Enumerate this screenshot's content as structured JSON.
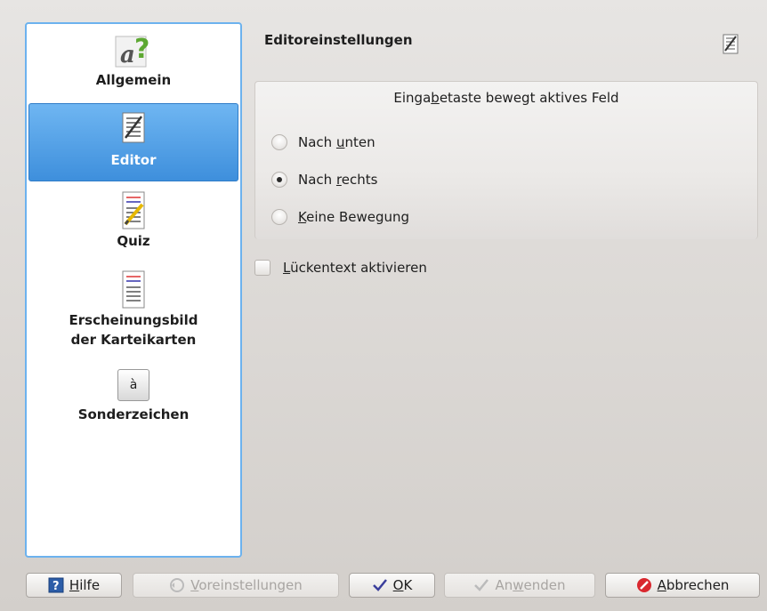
{
  "sidebar": {
    "items": [
      {
        "label": "Allgemein",
        "icon": "help-letter-icon"
      },
      {
        "label": "Editor",
        "icon": "editor-pencil-icon",
        "selected": true
      },
      {
        "label": "Quiz",
        "icon": "quiz-icon"
      },
      {
        "label": "Erscheinungsbild",
        "label2": "der Karteikarten",
        "icon": "appearance-icon"
      },
      {
        "label": "Sonderzeichen",
        "icon": "special-char-icon",
        "glyph": "à"
      }
    ]
  },
  "header": {
    "title": "Editoreinstellungen",
    "icon": "editor-pencil-icon"
  },
  "group": {
    "title_pre": "Einga",
    "title_acc": "b",
    "title_post": "etaste bewegt aktives Feld",
    "options": [
      {
        "pre": "Nach ",
        "acc": "u",
        "post": "nten",
        "checked": false
      },
      {
        "pre": "Nach ",
        "acc": "r",
        "post": "echts",
        "checked": true
      },
      {
        "pre": "",
        "acc": "K",
        "post": "eine Bewegung",
        "checked": false
      }
    ]
  },
  "cloze": {
    "acc": "L",
    "post": "ückentext aktivieren",
    "checked": false
  },
  "buttons": {
    "help": {
      "acc": "H",
      "post": "ilfe"
    },
    "defaults": {
      "acc": "V",
      "post": "oreinstellungen"
    },
    "ok": {
      "acc": "O",
      "post": "K"
    },
    "apply": {
      "pre": "An",
      "acc": "w",
      "post": "enden"
    },
    "cancel": {
      "acc": "A",
      "post": "bbrechen"
    }
  },
  "colors": {
    "accent": "#3e8fdc",
    "sidebar_border": "#6cb2ee",
    "cancel_icon": "#d9282f"
  }
}
